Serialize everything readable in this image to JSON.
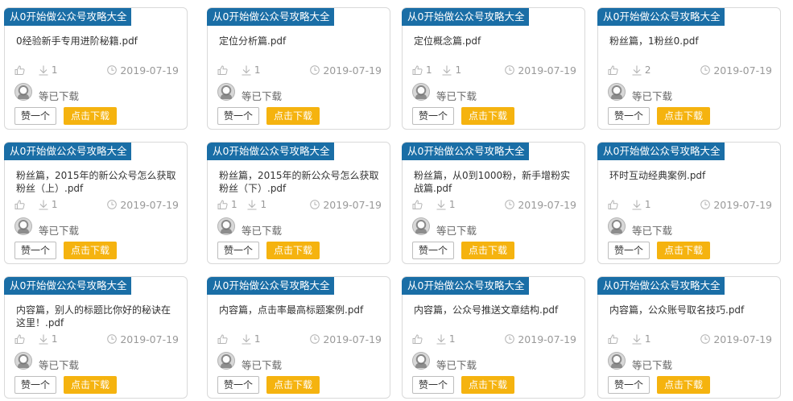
{
  "icons": {
    "like": "thumbs-up-icon",
    "download": "download-arrow-icon",
    "date": "clock-icon",
    "avatar": "user-avatar"
  },
  "colors": {
    "tag_bg": "#1a6ea6",
    "download_btn": "#f5b30f",
    "meta_text": "#999999"
  },
  "cards": [
    {
      "tag": "从0开始做公众号攻略大全",
      "title": "0经验新手专用进阶秘籍.pdf",
      "likes": "",
      "downloads": "1",
      "date": "2019-07-19",
      "downloaded_text": "等已下载",
      "like_btn": "赞一个",
      "download_btn": "点击下载"
    },
    {
      "tag": "从0开始做公众号攻略大全",
      "title": "定位分析篇.pdf",
      "likes": "",
      "downloads": "1",
      "date": "2019-07-19",
      "downloaded_text": "等已下载",
      "like_btn": "赞一个",
      "download_btn": "点击下载"
    },
    {
      "tag": "从0开始做公众号攻略大全",
      "title": "定位概念篇.pdf",
      "likes": "1",
      "downloads": "1",
      "date": "2019-07-19",
      "downloaded_text": "等已下载",
      "like_btn": "赞一个",
      "download_btn": "点击下载"
    },
    {
      "tag": "从0开始做公众号攻略大全",
      "title": "粉丝篇，1粉丝0.pdf",
      "likes": "",
      "downloads": "2",
      "date": "2019-07-19",
      "downloaded_text": "等已下载",
      "like_btn": "赞一个",
      "download_btn": "点击下载"
    },
    {
      "tag": "从0开始做公众号攻略大全",
      "title": "粉丝篇，2015年的新公众号怎么获取粉丝（上）.pdf",
      "likes": "",
      "downloads": "1",
      "date": "2019-07-19",
      "downloaded_text": "等已下载",
      "like_btn": "赞一个",
      "download_btn": "点击下载"
    },
    {
      "tag": "从0开始做公众号攻略大全",
      "title": "粉丝篇，2015年的新公众号怎么获取粉丝（下）.pdf",
      "likes": "1",
      "downloads": "1",
      "date": "2019-07-19",
      "downloaded_text": "等已下载",
      "like_btn": "赞一个",
      "download_btn": "点击下载"
    },
    {
      "tag": "从0开始做公众号攻略大全",
      "title": "粉丝篇，从0到1000粉，新手增粉实战篇.pdf",
      "likes": "",
      "downloads": "1",
      "date": "2019-07-19",
      "downloaded_text": "等已下载",
      "like_btn": "赞一个",
      "download_btn": "点击下载"
    },
    {
      "tag": "从0开始做公众号攻略大全",
      "title": "环时互动经典案例.pdf",
      "likes": "",
      "downloads": "1",
      "date": "2019-07-19",
      "downloaded_text": "等已下载",
      "like_btn": "赞一个",
      "download_btn": "点击下载"
    },
    {
      "tag": "从0开始做公众号攻略大全",
      "title": "内容篇，别人的标题比你好的秘诀在这里！.pdf",
      "likes": "",
      "downloads": "1",
      "date": "2019-07-19",
      "downloaded_text": "等已下载",
      "like_btn": "赞一个",
      "download_btn": "点击下载"
    },
    {
      "tag": "从0开始做公众号攻略大全",
      "title": "内容篇，点击率最高标题案例.pdf",
      "likes": "",
      "downloads": "1",
      "date": "2019-07-19",
      "downloaded_text": "等已下载",
      "like_btn": "赞一个",
      "download_btn": "点击下载"
    },
    {
      "tag": "从0开始做公众号攻略大全",
      "title": "内容篇，公众号推送文章结构.pdf",
      "likes": "",
      "downloads": "1",
      "date": "2019-07-19",
      "downloaded_text": "等已下载",
      "like_btn": "赞一个",
      "download_btn": "点击下载"
    },
    {
      "tag": "从0开始做公众号攻略大全",
      "title": "内容篇，公众账号取名技巧.pdf",
      "likes": "",
      "downloads": "1",
      "date": "2019-07-19",
      "downloaded_text": "等已下载",
      "like_btn": "赞一个",
      "download_btn": "点击下载"
    }
  ]
}
